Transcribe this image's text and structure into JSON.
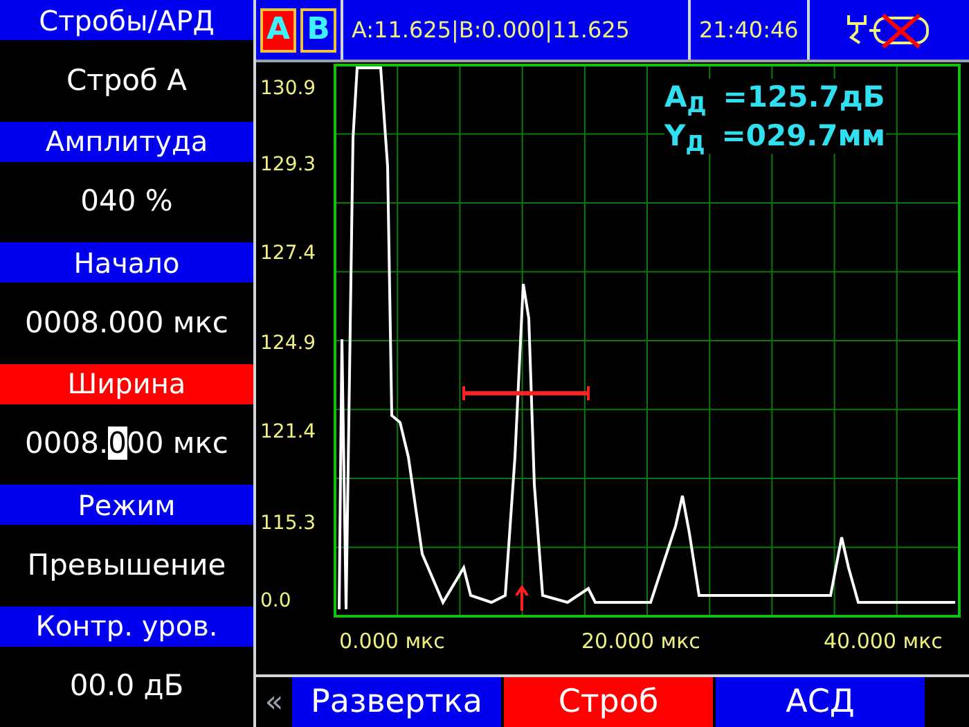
{
  "sidebar": [
    {
      "kind": "header",
      "label": "Стробы/АРД",
      "selected": false
    },
    {
      "kind": "value",
      "text": "Строб А"
    },
    {
      "kind": "header",
      "label": "Амплитуда",
      "selected": false
    },
    {
      "kind": "value",
      "text": "040 %"
    },
    {
      "kind": "header",
      "label": "Начало",
      "selected": false
    },
    {
      "kind": "value",
      "text": "0008.000 мкс"
    },
    {
      "kind": "header",
      "label": "Ширина",
      "selected": true
    },
    {
      "kind": "edit",
      "before": "0008.",
      "cursor": "0",
      "after": "00 мкс"
    },
    {
      "kind": "header",
      "label": "Режим",
      "selected": false
    },
    {
      "kind": "value",
      "text": "Превышение"
    },
    {
      "kind": "header",
      "label": "Контр. уров.",
      "selected": false
    },
    {
      "kind": "value",
      "text": "00.0 дБ"
    }
  ],
  "status_bar": {
    "channels": [
      {
        "label": "A",
        "selected": true
      },
      {
        "label": "B",
        "selected": false
      }
    ],
    "readout": "A:11.625|B:0.000|11.625",
    "time": "21:40:46"
  },
  "chart": {
    "y_labels": [
      "130.9",
      "129.3",
      "127.4",
      "124.9",
      "121.4",
      "115.3",
      "0.0"
    ],
    "x_labels": [
      "0.000 мкс",
      "20.000 мкс",
      "40.000 мкс"
    ],
    "measurements": [
      {
        "label": "A$_{Д}$",
        "value": "=125.7дБ"
      },
      {
        "label": "Y$_{Д}$",
        "value": "=029.7мм"
      }
    ]
  },
  "tabs": [
    {
      "label": "«",
      "kind": "arrow"
    },
    {
      "label": "Развертка",
      "kind": "tab",
      "selected": false
    },
    {
      "label": "Строб",
      "kind": "tab",
      "selected": true
    },
    {
      "label": "АСД",
      "kind": "tab",
      "selected": false
    }
  ]
}
